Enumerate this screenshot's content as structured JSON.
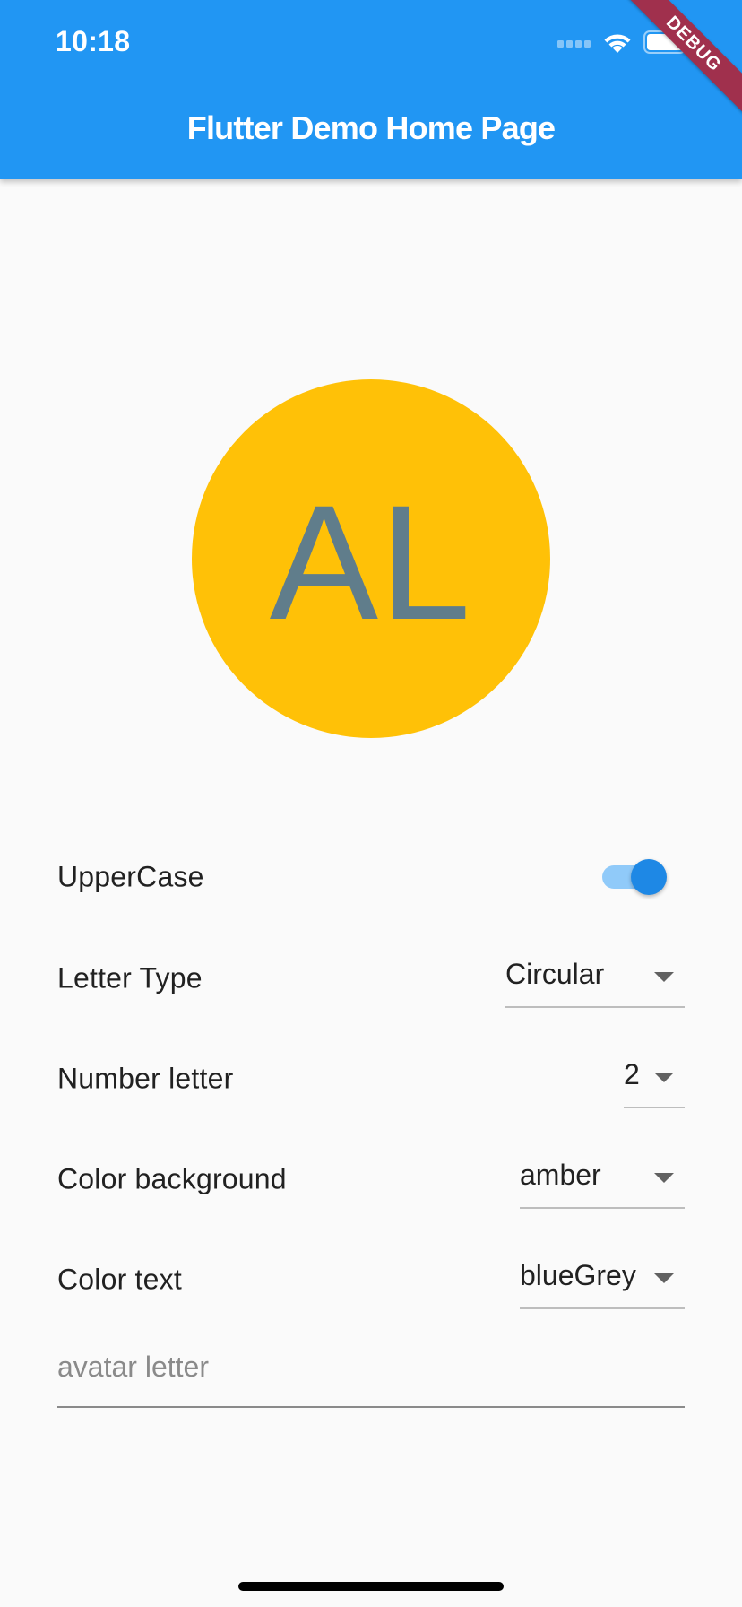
{
  "status_bar": {
    "time": "10:18",
    "icons": [
      "cellular-icon",
      "wifi-icon",
      "battery-icon"
    ]
  },
  "app_bar": {
    "title": "Flutter Demo Home Page",
    "color": "#2196F3"
  },
  "debug_banner": {
    "label": "DEBUG",
    "color": "#a0304d"
  },
  "avatar": {
    "letters": "AL",
    "background_color": "#FFC107",
    "text_color": "#607D8B"
  },
  "settings": {
    "uppercase": {
      "label": "UpperCase",
      "enabled": true,
      "track_color": "#90CAF9",
      "thumb_color": "#1E88E5"
    },
    "letter_type": {
      "label": "Letter Type",
      "value": "Circular"
    },
    "number_letter": {
      "label": "Number letter",
      "value": "2"
    },
    "color_background": {
      "label": "Color background",
      "value": "amber"
    },
    "color_text": {
      "label": "Color text",
      "value": "blueGrey"
    }
  },
  "avatar_input": {
    "placeholder": "avatar letter",
    "value": ""
  }
}
